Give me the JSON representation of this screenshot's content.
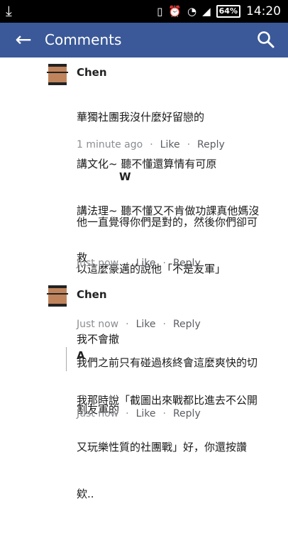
{
  "status_bar": {
    "time": "14:20",
    "battery": "64%"
  },
  "app_bar": {
    "title": "Comments"
  },
  "comments": [
    {
      "name": "Chen",
      "lines": [
        "華獨社團我沒什麼好留戀的",
        "講文化~ 聽不懂還算情有可原",
        "講法理~ 聽不懂又不肯做功課真他媽沒",
        "救"
      ],
      "time": "1 minute ago",
      "like": "Like",
      "reply": "Reply"
    },
    {
      "name": "W",
      "lines": [
        "他一直覺得你們是對的，然後你們卻可",
        "以這麼豪邁的說他「不是友軍」",
        "",
        "我們之前只有碰過核終會這麼爽快的切",
        "割友軍的"
      ],
      "time": "Just now",
      "like": "Like",
      "reply": "Reply"
    },
    {
      "name": "Chen",
      "lines": [
        "我不會撤"
      ],
      "time": "Just now",
      "like": "Like",
      "reply": "Reply"
    },
    {
      "name": "A",
      "lines": [
        "我那時說「截圖出來戰都比進去不公開",
        "又玩樂性質的社團戰」好，你還按讚",
        "欸.."
      ],
      "time": "Just now",
      "like": "Like",
      "reply": "Reply"
    }
  ]
}
